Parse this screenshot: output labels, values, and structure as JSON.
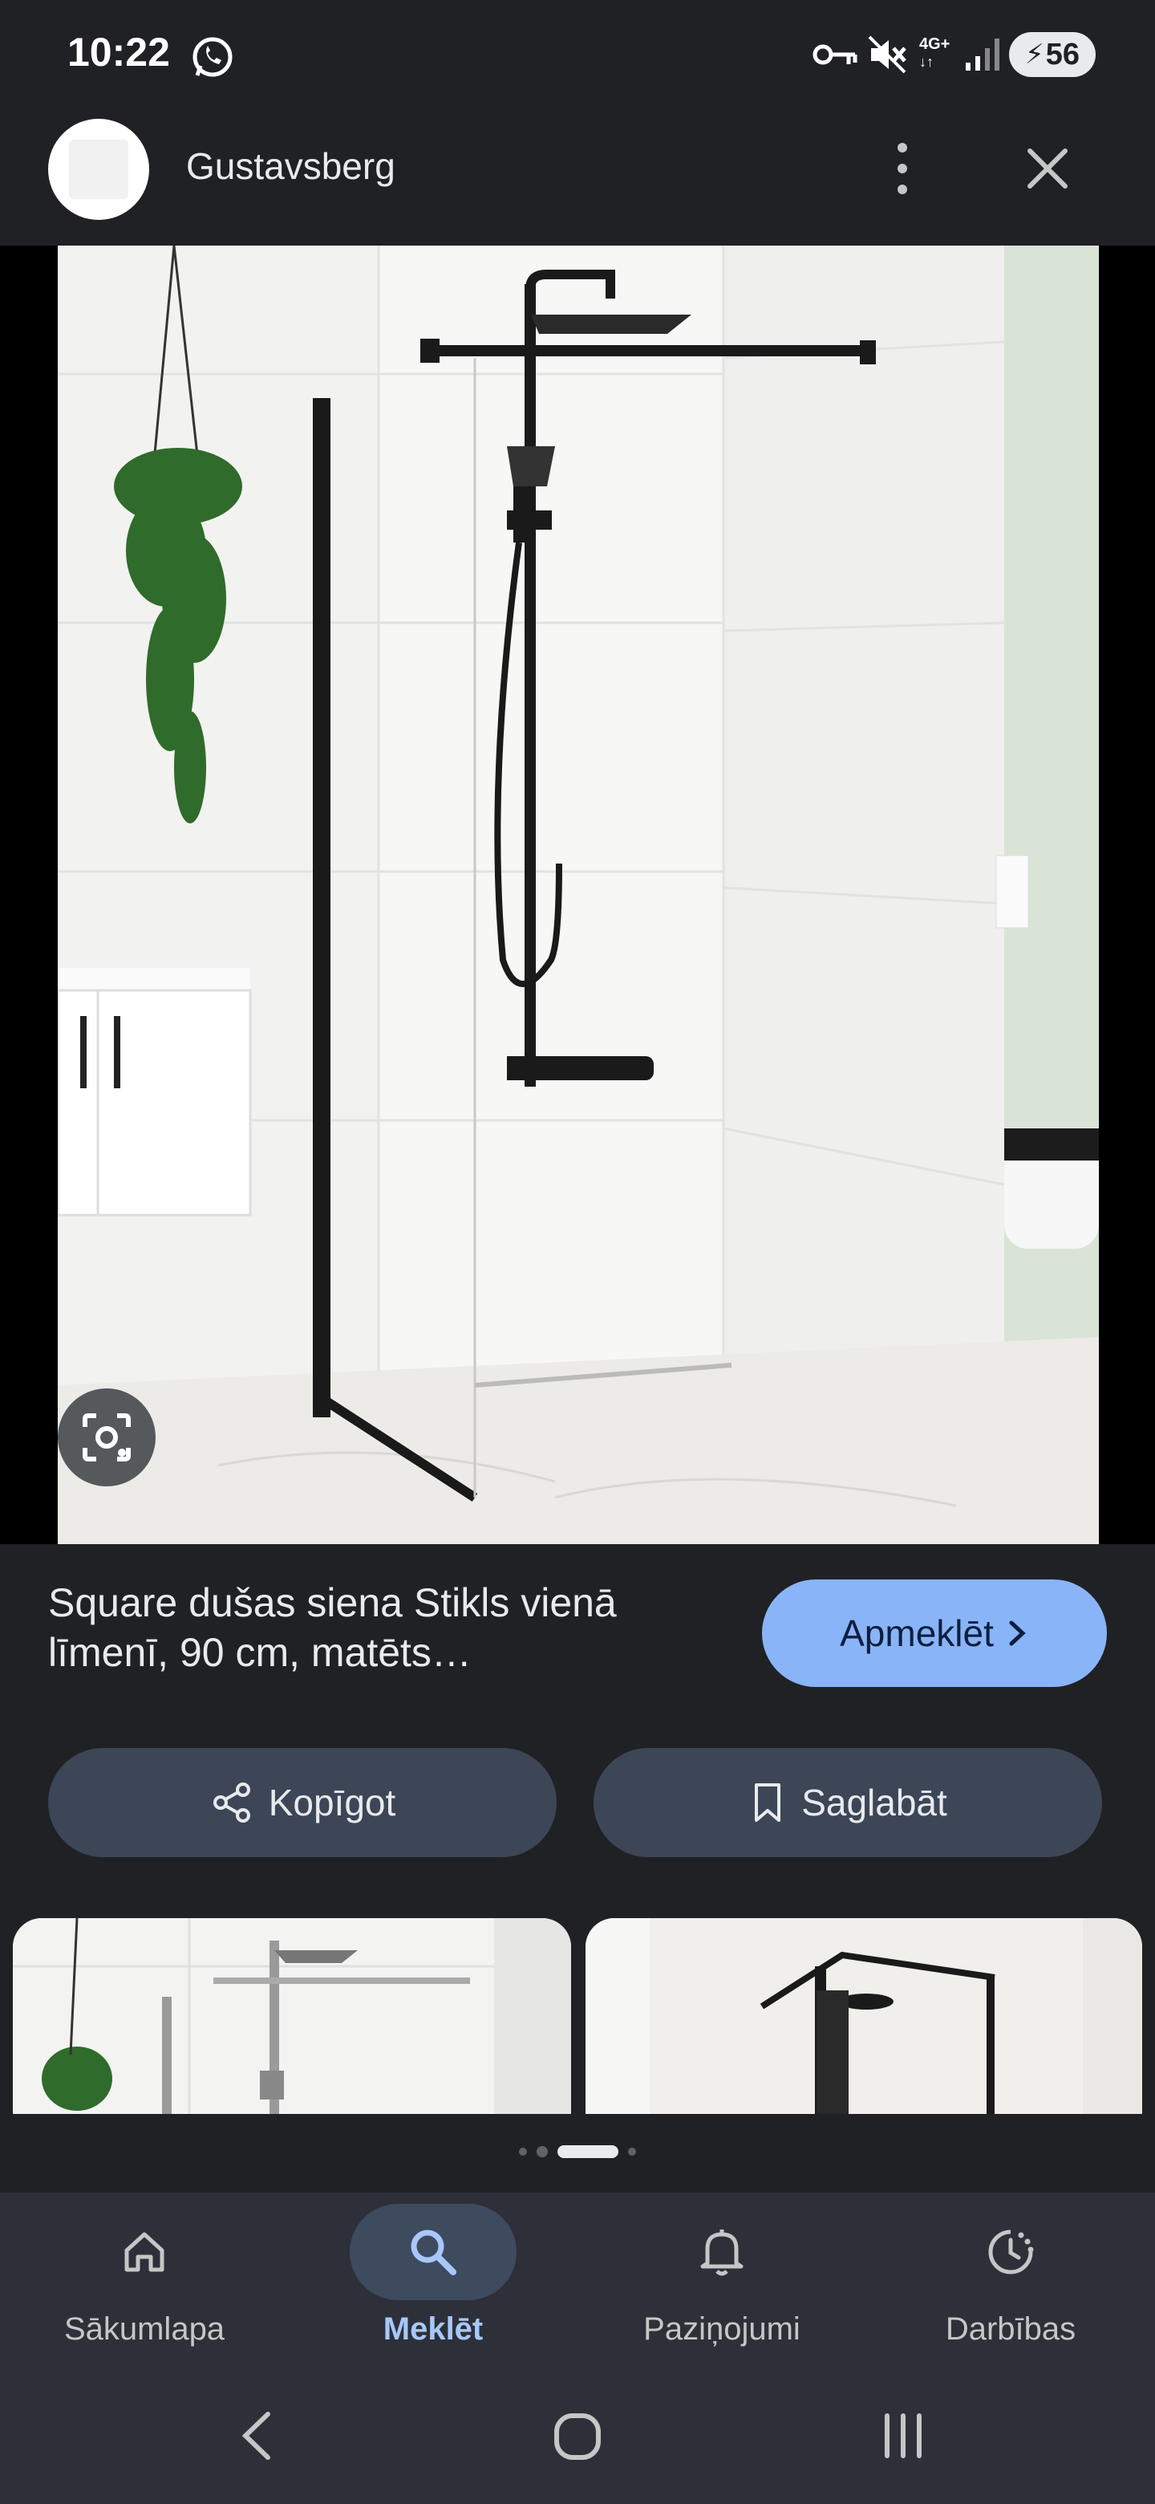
{
  "status_bar": {
    "time": "10:22",
    "network": "4G+",
    "battery": "56",
    "icons": [
      "whatsapp-icon",
      "vpn-key-icon",
      "mute-icon",
      "signal-icon",
      "battery-charging-icon"
    ]
  },
  "header": {
    "site_name": "Gustavsberg",
    "icons": [
      "more-vert-icon",
      "close-icon"
    ]
  },
  "result": {
    "title": "Square dušas siena Stikls vienā līmenī, 90 cm, matēts…",
    "visit_label": "Apmeklēt",
    "share_label": "Kopīgot",
    "save_label": "Saglabāt"
  },
  "carousel": {
    "pages": 4,
    "active_index": 2
  },
  "bottom_nav": {
    "items": [
      {
        "label": "Sākumlapa",
        "icon": "home-icon"
      },
      {
        "label": "Meklēt",
        "icon": "search-icon"
      },
      {
        "label": "Paziņojumi",
        "icon": "bell-icon"
      },
      {
        "label": "Darbības",
        "icon": "activity-icon"
      }
    ],
    "active": "Meklēt"
  },
  "colors": {
    "background": "#202124",
    "accent": "#8ab4f8",
    "pill": "#3c4656",
    "nav_bg": "#2d3038"
  }
}
